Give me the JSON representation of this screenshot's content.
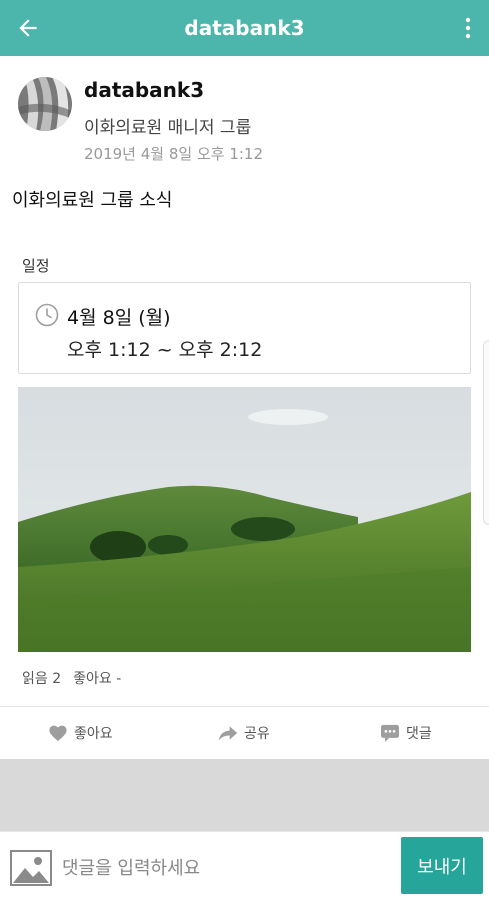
{
  "appbar": {
    "title": "databank3",
    "back_icon": "arrow-left-icon",
    "more_icon": "more-vert-icon",
    "color": "#4db6ac"
  },
  "post": {
    "author": "databank3",
    "group": "이화의료원 매니저 그룹",
    "date": "2019년 4월 8일 오후 1:12",
    "body": "이화의료원 그룹 소식"
  },
  "schedule": {
    "label": "일정",
    "date": "4월 8일 (월)",
    "time": "오후 1:12 ~ 오후 2:12",
    "icon": "clock-icon"
  },
  "stats": {
    "read": "읽음 2",
    "likes": "좋아요 -"
  },
  "actions": {
    "like_label": "좋아요",
    "share_label": "공유",
    "comment_label": "댓글"
  },
  "comment_bar": {
    "placeholder": "댓글을 입력하세요",
    "send_label": "보내기",
    "accent": "#26a69a"
  }
}
